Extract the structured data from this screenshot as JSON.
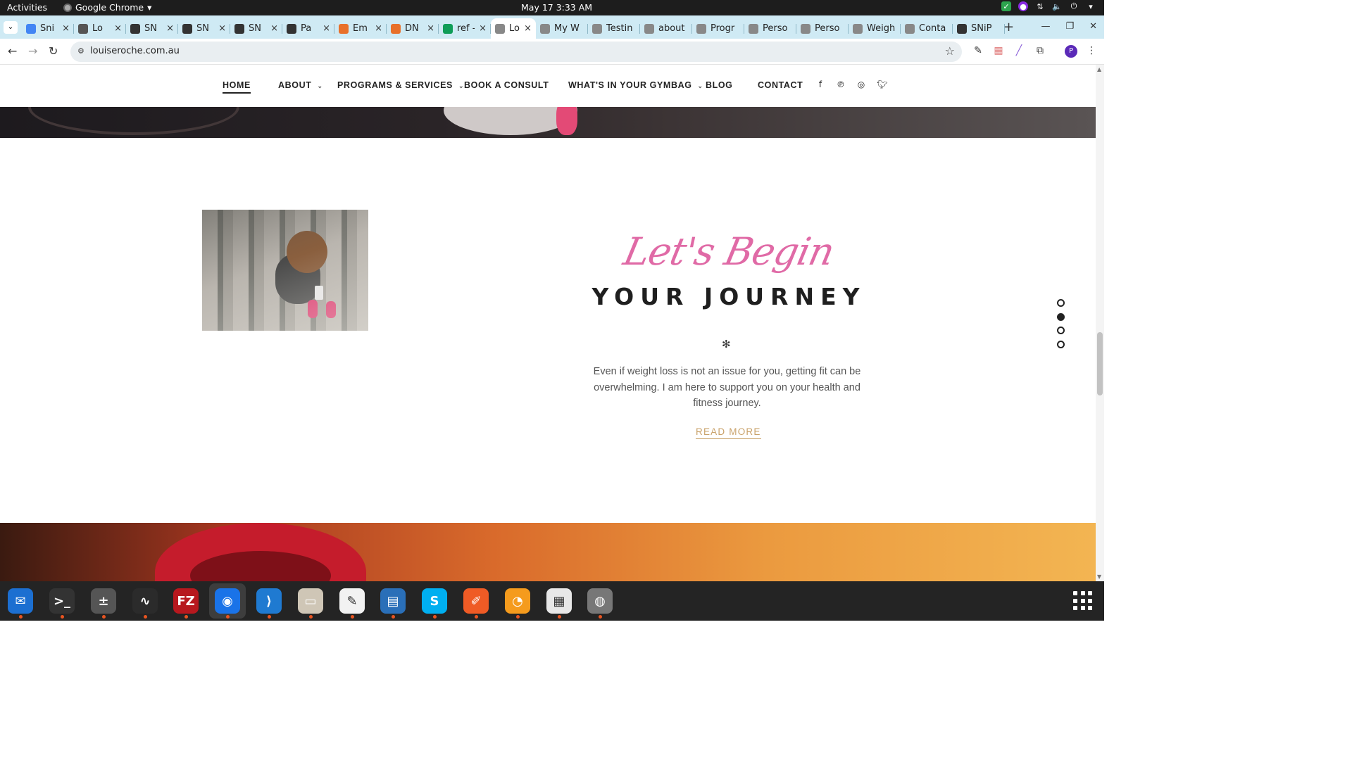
{
  "system_bar": {
    "activities": "Activities",
    "app_name": "Google Chrome",
    "clock": "May 17  3:33 AM"
  },
  "tabs": [
    {
      "title": "Sni",
      "icon": "google-docs-icon",
      "color": "#4285f4"
    },
    {
      "title": "Lo",
      "icon": "letter-l-icon",
      "color": "#555555"
    },
    {
      "title": "SN",
      "icon": "snip-icon",
      "color": "#333333"
    },
    {
      "title": "SN",
      "icon": "snip-icon",
      "color": "#333333"
    },
    {
      "title": "SN",
      "icon": "snip-icon",
      "color": "#333333"
    },
    {
      "title": "Pa",
      "icon": "snip-icon",
      "color": "#333333"
    },
    {
      "title": "Em",
      "icon": "email-icon",
      "color": "#e8702a"
    },
    {
      "title": "DN",
      "icon": "email-icon",
      "color": "#e8702a"
    },
    {
      "title": "ref - G",
      "icon": "google-sheets-icon",
      "color": "#0f9d58"
    },
    {
      "title": "Lo",
      "icon": "lr-site-icon",
      "color": "#888888",
      "active": true
    },
    {
      "title": "My W",
      "icon": "lr-site-icon",
      "color": "#888888"
    },
    {
      "title": "Testin",
      "icon": "lr-site-icon",
      "color": "#888888"
    },
    {
      "title": "about",
      "icon": "lr-site-icon",
      "color": "#888888"
    },
    {
      "title": "Progr",
      "icon": "lr-site-icon",
      "color": "#888888"
    },
    {
      "title": "Perso",
      "icon": "lr-site-icon",
      "color": "#888888"
    },
    {
      "title": "Perso",
      "icon": "lr-site-icon",
      "color": "#888888"
    },
    {
      "title": "Weigh",
      "icon": "lr-site-icon",
      "color": "#888888"
    },
    {
      "title": "Conta",
      "icon": "lr-site-icon",
      "color": "#888888"
    },
    {
      "title": "SNiP",
      "icon": "snip-icon",
      "color": "#333333"
    }
  ],
  "address_bar": {
    "url": "louiseroche.com.au"
  },
  "profile_initial": "P",
  "site_nav": {
    "items": [
      {
        "label": "HOME",
        "dropdown": false,
        "current": true
      },
      {
        "label": "ABOUT",
        "dropdown": true
      },
      {
        "label": "PROGRAMS & SERVICES",
        "dropdown": true
      },
      {
        "label": "BOOK A CONSULT",
        "dropdown": false
      },
      {
        "label": "WHAT'S IN YOUR GYMBAG",
        "dropdown": true
      },
      {
        "label": "BLOG",
        "dropdown": false
      },
      {
        "label": "CONTACT",
        "dropdown": false
      }
    ],
    "social": [
      "facebook-icon",
      "pinterest-icon",
      "instagram-icon",
      "twitter-icon"
    ]
  },
  "section": {
    "script_heading": "Let's Begin",
    "heading": "YOUR JOURNEY",
    "ornament": "✻",
    "body": "Even if weight loss is not an issue for you, getting fit can be overwhelming.  I am here to support you on your health and fitness journey.",
    "cta": "READ MORE"
  },
  "slide_dots": {
    "count": 4,
    "active_index": 1
  },
  "colors": {
    "script_pink": "#e06aa6",
    "cta_gold": "#c9a26a",
    "tabstrip": "#cfeaf4"
  },
  "dock": [
    "thunderbird-icon",
    "terminal-icon",
    "calculator-icon",
    "system-monitor-icon",
    "filezilla-icon",
    "chrome-icon",
    "vscode-icon",
    "files-icon",
    "text-editor-icon",
    "libreoffice-writer-icon",
    "skype-icon",
    "postman-icon",
    "blender-like-icon",
    "document-viewer-icon",
    "disk-icon"
  ]
}
